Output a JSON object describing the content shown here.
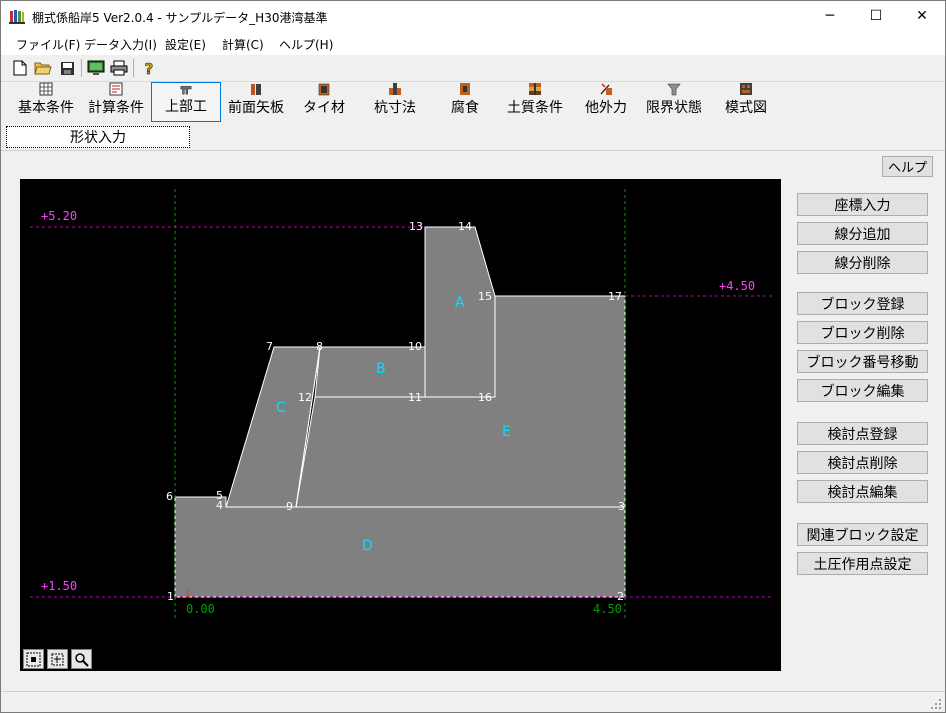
{
  "window": {
    "title": "棚式係船岸5 Ver2.0.4 - サンプルデータ_H30港湾基準",
    "minimize": "─",
    "maximize": "☐",
    "close": "✕"
  },
  "menu": [
    "ファイル(F)",
    "データ入力(I)",
    "設定(E)",
    "計算(C)",
    "ヘルプ(H)"
  ],
  "toolbar_icons": [
    "new-file-icon",
    "open-folder-icon",
    "save-icon",
    "monitor-icon",
    "print-icon",
    "help-question-icon"
  ],
  "tabs": [
    "基本条件",
    "計算条件",
    "上部工",
    "前面矢板",
    "タイ材",
    "杭寸法",
    "腐食",
    "土質条件",
    "他外力",
    "限界状態",
    "模式図"
  ],
  "active_tab": "上部工",
  "subtab": "形状入力",
  "help_button": "ヘルプ",
  "side_buttons": {
    "coord_input": "座標入力",
    "add_segment": "線分追加",
    "delete_segment": "線分削除",
    "register_block": "ブロック登録",
    "delete_block": "ブロック削除",
    "move_block_number": "ブロック番号移動",
    "edit_block": "ブロック編集",
    "register_check_point": "検討点登録",
    "delete_check_point": "検討点削除",
    "edit_check_point": "検討点編集",
    "related_block_settings": "関連ブロック設定",
    "earth_pressure_point_settings": "土圧作用点設定"
  },
  "drawing": {
    "levels": {
      "top": "+5.20",
      "right": "+4.50",
      "bottom": "+1.50"
    },
    "x_labels": {
      "left": "0.00",
      "right": "4.50"
    },
    "block_labels": [
      "A",
      "B",
      "C",
      "D",
      "E"
    ],
    "point_labels": [
      "13",
      "14",
      "15",
      "17",
      "7",
      "8",
      "10",
      "12",
      "11",
      "16",
      "6",
      "5",
      "4",
      "9",
      "3",
      "1",
      "1",
      "2"
    ],
    "colors": {
      "background": "#000000",
      "fill": "#808080",
      "level_line": "#c000c0",
      "grid_line": "#00a000",
      "block_label": "#00e0ff",
      "point_label": "#ffffff",
      "origin_label": "#ff3030"
    }
  }
}
